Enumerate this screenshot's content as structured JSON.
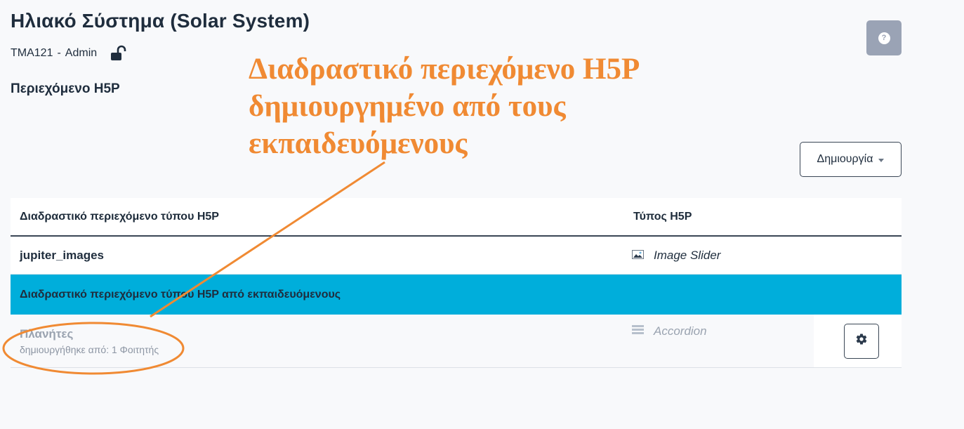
{
  "header": {
    "title": "Ηλιακό Σύστημα (Solar System)",
    "course_code": "TMA121",
    "separator": "-",
    "role": "Admin",
    "lock_icon": "unlock-icon",
    "section_title": "Περιεχόμενο H5P",
    "help_icon": "help-icon",
    "help_label": "?"
  },
  "toolbar": {
    "create_label": "Δημιουργία"
  },
  "annotation": {
    "text": "Διαδραστικό περιεχόμενο H5P δημιουργημένο από τους εκπαιδευόμενους",
    "color": "#f08a33"
  },
  "table": {
    "headers": [
      "Διαδραστικό περιεχόμενο τύπου H5P",
      "Τύπος H5P"
    ],
    "rows": [
      {
        "title": "jupiter_images",
        "type": "Image Slider",
        "type_icon": "image-icon"
      }
    ],
    "group_label": "Διαδραστικό περιεχόμενο τύπου H5P από εκπαιδευόμενους",
    "group_color": "#00aedb",
    "student_rows": [
      {
        "title": "Πλανήτες",
        "created_by": "δημιουργήθηκε από: 1 Φοιτητής",
        "type": "Accordion",
        "type_icon": "accordion-icon",
        "action_icon": "gear-icon"
      }
    ]
  }
}
